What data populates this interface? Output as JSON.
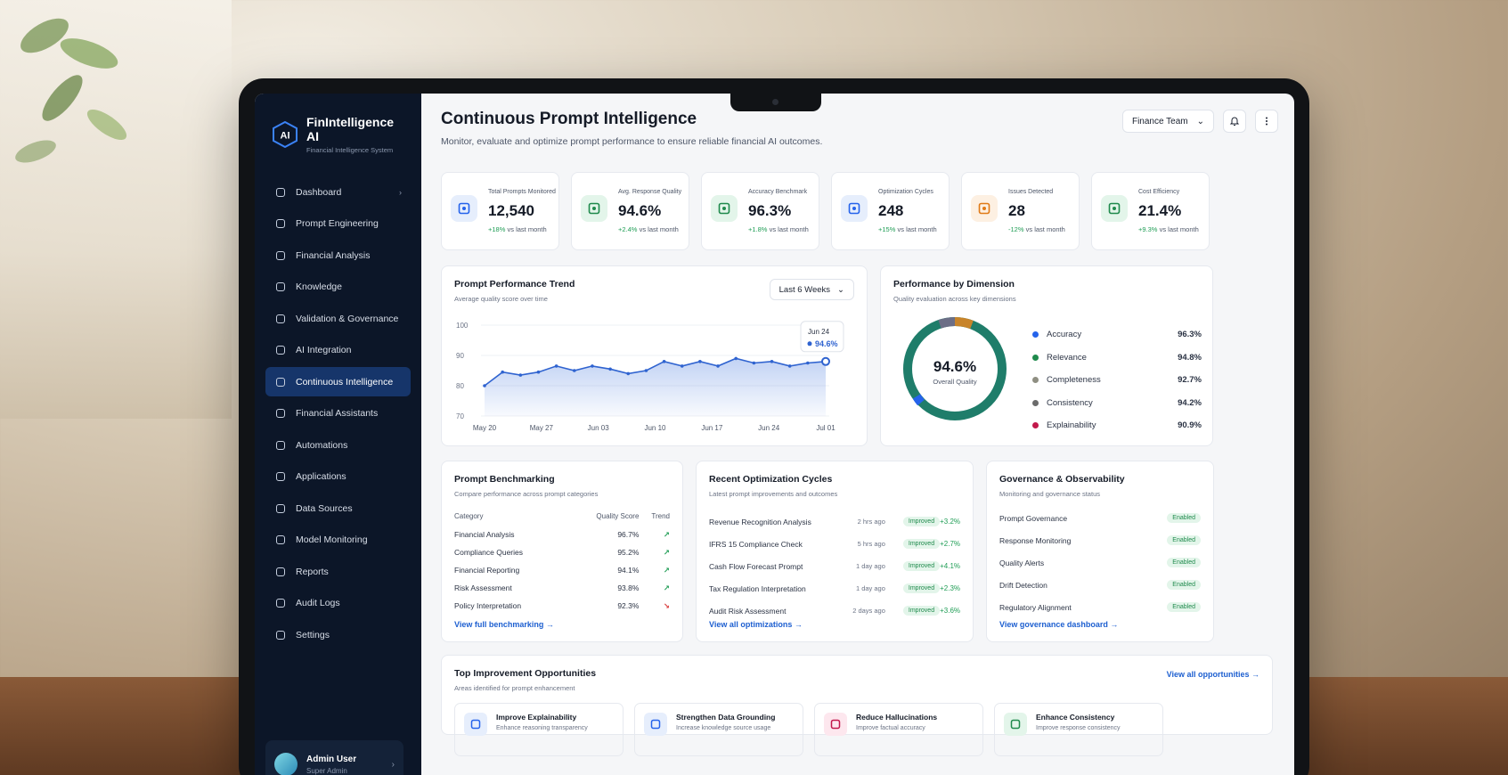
{
  "brand": {
    "logo": "AI",
    "name": "FinIntelligence AI",
    "subtitle": "Financial Intelligence System"
  },
  "sidebar": {
    "items": [
      {
        "label": "Dashboard",
        "icon": "home-icon"
      },
      {
        "label": "Prompt Engineering",
        "icon": "prompt-icon"
      },
      {
        "label": "Financial Analysis",
        "icon": "analysis-icon"
      },
      {
        "label": "Knowledge",
        "icon": "knowledge-icon"
      },
      {
        "label": "Validation & Governance",
        "icon": "shield-icon"
      },
      {
        "label": "AI Integration",
        "icon": "integration-icon"
      },
      {
        "label": "Continuous Intelligence",
        "icon": "intelligence-icon"
      },
      {
        "label": "Financial Assistants",
        "icon": "assistant-icon"
      },
      {
        "label": "Automations",
        "icon": "automation-icon"
      },
      {
        "label": "Applications",
        "icon": "apps-icon"
      },
      {
        "label": "Data Sources",
        "icon": "database-icon"
      },
      {
        "label": "Model Monitoring",
        "icon": "monitor-icon"
      },
      {
        "label": "Reports",
        "icon": "report-icon"
      },
      {
        "label": "Audit Logs",
        "icon": "log-icon"
      },
      {
        "label": "Settings",
        "icon": "gear-icon"
      }
    ],
    "active_index": 6,
    "user": {
      "name": "Admin User",
      "role": "Super Admin"
    }
  },
  "header": {
    "title": "Continuous Prompt Intelligence",
    "subtitle": "Monitor, evaluate and optimize prompt performance to ensure reliable financial AI outcomes.",
    "team_select": "Finance Team"
  },
  "kpis": [
    {
      "label": "Total Prompts Monitored",
      "value": "12,540",
      "delta": "+18%",
      "delta_suffix": "vs last month",
      "color": "#2563eb",
      "bg": "#e6eefc"
    },
    {
      "label": "Avg. Response Quality",
      "value": "94.6%",
      "delta": "+2.4%",
      "delta_suffix": "vs last month",
      "color": "#1f8a4c",
      "bg": "#e3f5ea"
    },
    {
      "label": "Accuracy Benchmark",
      "value": "96.3%",
      "delta": "+1.8%",
      "delta_suffix": "vs last month",
      "color": "#1f8a4c",
      "bg": "#e3f5ea"
    },
    {
      "label": "Optimization Cycles",
      "value": "248",
      "delta": "+15%",
      "delta_suffix": "vs last month",
      "color": "#2563eb",
      "bg": "#e6eefc"
    },
    {
      "label": "Issues Detected",
      "value": "28",
      "delta": "-12%",
      "delta_suffix": "vs last month",
      "color": "#e07a16",
      "bg": "#fdf0e2"
    },
    {
      "label": "Cost Efficiency",
      "value": "21.4%",
      "delta": "+9.3%",
      "delta_suffix": "vs last month",
      "color": "#1f8a4c",
      "bg": "#e3f5ea"
    }
  ],
  "trend": {
    "title": "Prompt Performance Trend",
    "subtitle": "Average quality score over time",
    "range": "Last 6 Weeks",
    "tooltip_date": "Jun 24",
    "tooltip_value": "94.6%"
  },
  "chart_data": {
    "type": "area",
    "x": [
      "May 20",
      "May 27",
      "Jun 03",
      "Jun 10",
      "Jun 17",
      "Jun 24",
      "Jul 01"
    ],
    "y_ticks": [
      100,
      90,
      80,
      70
    ],
    "ylim": [
      70,
      100
    ],
    "values": [
      80,
      84.5,
      83.5,
      84.5,
      86.5,
      85,
      86.5,
      85.5,
      84,
      85,
      88,
      86.5,
      88,
      86.5,
      89,
      87.5,
      88,
      86.5,
      87.5,
      88
    ]
  },
  "dimension": {
    "title": "Performance by Dimension",
    "subtitle": "Quality evaluation across key dimensions",
    "center_value": "94.6%",
    "center_label": "Overall Quality",
    "items": [
      {
        "label": "Accuracy",
        "value": "96.3%",
        "color": "#2563eb"
      },
      {
        "label": "Relevance",
        "value": "94.8%",
        "color": "#1f8a4c"
      },
      {
        "label": "Completeness",
        "value": "92.7%",
        "color": "#8f8f82"
      },
      {
        "label": "Consistency",
        "value": "94.2%",
        "color": "#6b6b6b"
      },
      {
        "label": "Explainability",
        "value": "90.9%",
        "color": "#c2184b"
      }
    ]
  },
  "benchmark": {
    "title": "Prompt Benchmarking",
    "subtitle": "Compare performance across prompt categories",
    "headers": [
      "Category",
      "Quality Score",
      "Trend"
    ],
    "rows": [
      {
        "category": "Financial Analysis",
        "score": "96.7%",
        "trend": "↗",
        "dir": "up"
      },
      {
        "category": "Compliance Queries",
        "score": "95.2%",
        "trend": "↗",
        "dir": "up"
      },
      {
        "category": "Financial Reporting",
        "score": "94.1%",
        "trend": "↗",
        "dir": "up"
      },
      {
        "category": "Risk Assessment",
        "score": "93.8%",
        "trend": "↗",
        "dir": "up"
      },
      {
        "category": "Policy Interpretation",
        "score": "92.3%",
        "trend": "↘",
        "dir": "down"
      }
    ],
    "link": "View full benchmarking →"
  },
  "optimization": {
    "title": "Recent Optimization Cycles",
    "subtitle": "Latest prompt improvements and outcomes",
    "rows": [
      {
        "name": "Revenue Recognition Analysis",
        "time": "2 hrs ago",
        "status": "Improved",
        "delta": "+3.2%"
      },
      {
        "name": "IFRS 15 Compliance Check",
        "time": "5 hrs ago",
        "status": "Improved",
        "delta": "+2.7%"
      },
      {
        "name": "Cash Flow Forecast Prompt",
        "time": "1 day ago",
        "status": "Improved",
        "delta": "+4.1%"
      },
      {
        "name": "Tax Regulation Interpretation",
        "time": "1 day ago",
        "status": "Improved",
        "delta": "+2.3%"
      },
      {
        "name": "Audit Risk Assessment",
        "time": "2 days ago",
        "status": "Improved",
        "delta": "+3.6%"
      }
    ],
    "link": "View all optimizations →"
  },
  "governance": {
    "title": "Governance & Observability",
    "subtitle": "Monitoring and governance status",
    "rows": [
      {
        "name": "Prompt Governance",
        "status": "Enabled"
      },
      {
        "name": "Response Monitoring",
        "status": "Enabled"
      },
      {
        "name": "Quality Alerts",
        "status": "Enabled"
      },
      {
        "name": "Drift Detection",
        "status": "Enabled"
      },
      {
        "name": "Regulatory Alignment",
        "status": "Enabled"
      }
    ],
    "link": "View governance dashboard →"
  },
  "opportunities": {
    "title": "Top Improvement Opportunities",
    "subtitle": "Areas identified for prompt enhancement",
    "link": "View all opportunities →",
    "items": [
      {
        "title": "Improve Explainability",
        "sub": "Enhance reasoning transparency",
        "color": "#2563eb",
        "bg": "#e6eefc"
      },
      {
        "title": "Strengthen Data Grounding",
        "sub": "Increase knowledge source usage",
        "color": "#2563eb",
        "bg": "#e6eefc"
      },
      {
        "title": "Reduce Hallucinations",
        "sub": "Improve factual accuracy",
        "color": "#c2184b",
        "bg": "#fde7ee"
      },
      {
        "title": "Enhance Consistency",
        "sub": "Improve response consistency",
        "color": "#1f8a4c",
        "bg": "#e3f5ea"
      }
    ]
  }
}
